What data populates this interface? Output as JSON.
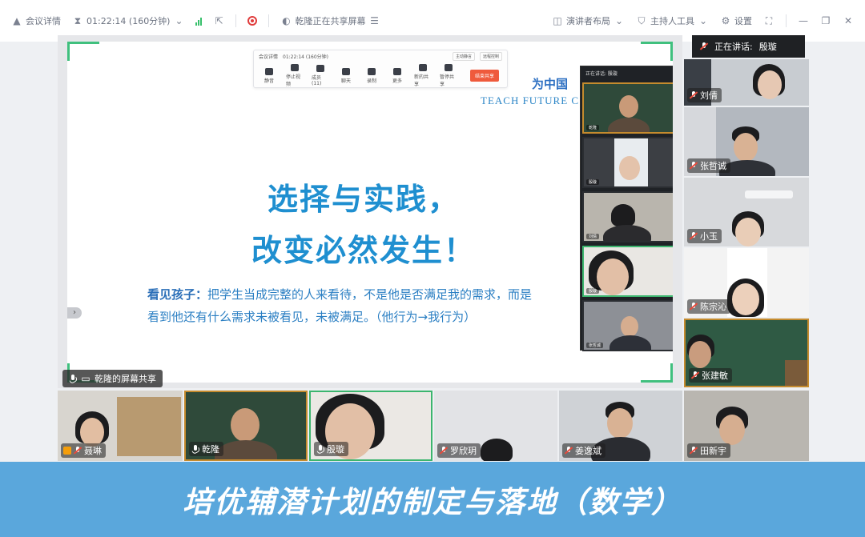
{
  "toolbar": {
    "meeting_info": "会议详情",
    "timer": "01:22:14 (160分钟)",
    "sharing_status": "乾隆正在共享屏幕",
    "layout": "演讲者布局",
    "host_tools": "主持人工具",
    "settings": "设置"
  },
  "speaking": {
    "label": "正在讲话:",
    "name": "殷璇"
  },
  "slide": {
    "logo_cn": "为中国",
    "logo_en": "TEACH FUTURE C",
    "title_line1": "选择与实践，",
    "title_line2": "改变必然发生！",
    "body_bold": "看见孩子：",
    "body_line1": "把学生当成完整的人来看待，不是他是否满足我的需求，而是",
    "body_line2": "看到他还有什么需求未被看见，未被满足。（他行为→我行为）"
  },
  "mini_toolbar": {
    "info": "会议详情",
    "timer": "01:22:14 (160分钟)",
    "chip1": "主动静言",
    "chip2": "远程控制",
    "buttons": [
      "静音",
      "停止视频",
      "成员(11)",
      "聊天",
      "录制",
      "更多",
      "新的共享",
      "暂停共享"
    ],
    "end_share": "结束共享"
  },
  "mini_video": {
    "header": "正在讲话: 殷璇",
    "names": [
      "乾隆",
      "殷璇",
      "刘倩",
      "殷璇",
      "张哲诚"
    ]
  },
  "share_label": "乾隆的屏幕共享",
  "right_tiles": [
    "刘倩",
    "张哲诚",
    "小玉",
    "陈宗沁",
    "张建敏"
  ],
  "bottom_tiles": [
    "聂琳",
    "乾隆",
    "殷璇",
    "罗欣玥",
    "姜逸斌",
    "田新宇"
  ],
  "banner": "培优辅潜计划的制定与落地（数学）",
  "colors": {
    "banner_bg": "#5aa7dc",
    "slide_title": "#1f8fd0",
    "active_border": "#3cb56e",
    "record_red": "#e03b3b"
  }
}
